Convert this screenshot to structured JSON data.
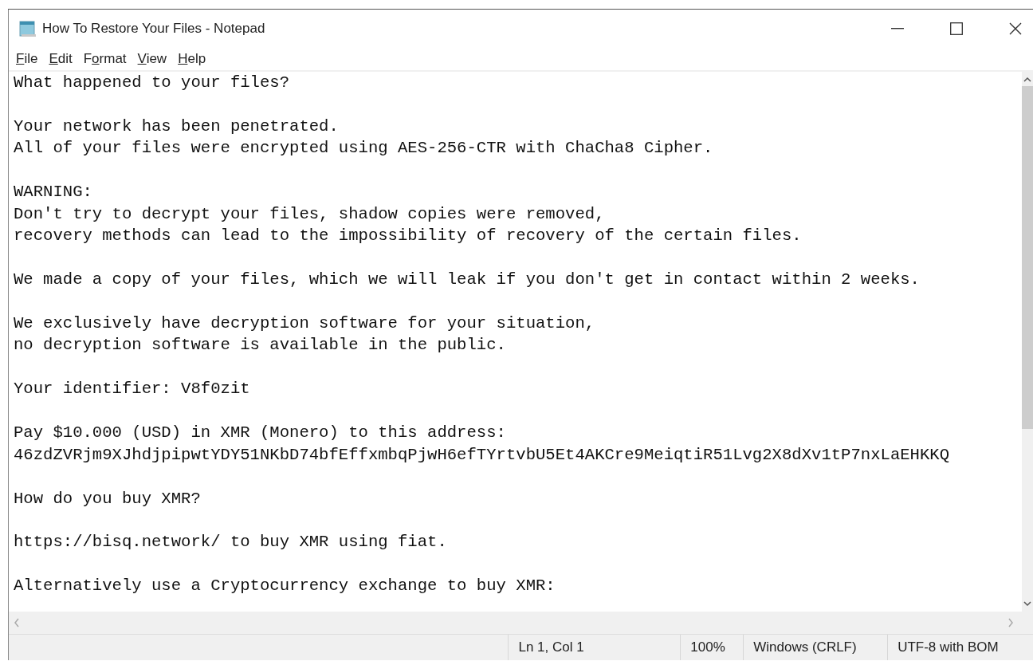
{
  "window": {
    "title": "How To Restore Your Files - Notepad"
  },
  "menu": [
    {
      "label": "File",
      "second_letter_underlined": false
    },
    {
      "label": "Edit",
      "second_letter_underlined": false
    },
    {
      "label": "Format",
      "second_letter_underlined": true
    },
    {
      "label": "View",
      "second_letter_underlined": false
    },
    {
      "label": "Help",
      "second_letter_underlined": false
    }
  ],
  "document": {
    "paragraphs": [
      [
        "What happened to your files?"
      ],
      [
        "Your network has been penetrated.",
        "All of your files were encrypted using AES-256-CTR with ChaCha8 Cipher."
      ],
      [
        "WARNING:",
        "Don't try to decrypt your files, shadow copies were removed,",
        "recovery methods can lead to the impossibility of recovery of the certain files."
      ],
      [
        "We made a copy of your files, which we will leak if you don't get in contact within 2 weeks."
      ],
      [
        "We exclusively have decryption software for your situation,",
        "no decryption software is available in the public."
      ],
      [
        "Your identifier: V8f0zit"
      ],
      [
        "Pay $10.000 (USD) in XMR (Monero) to this address:",
        "46zdZVRjm9XJhdjpipwtYDY51NKbD74bfEffxmbqPjwH6efTYrtvbU5Et4AKCre9MeiqtiR51Lvg2X8dXv1tP7nxLaEHKKQ"
      ],
      [
        "How do you buy XMR?"
      ],
      [
        "https://bisq.network/ to buy XMR using fiat."
      ],
      [
        "Alternatively use a Cryptocurrency exchange to buy XMR:"
      ]
    ]
  },
  "status_bar": [
    "Ln 1, Col 1",
    "100%",
    "Windows (CRLF)",
    "UTF-8 with BOM"
  ]
}
